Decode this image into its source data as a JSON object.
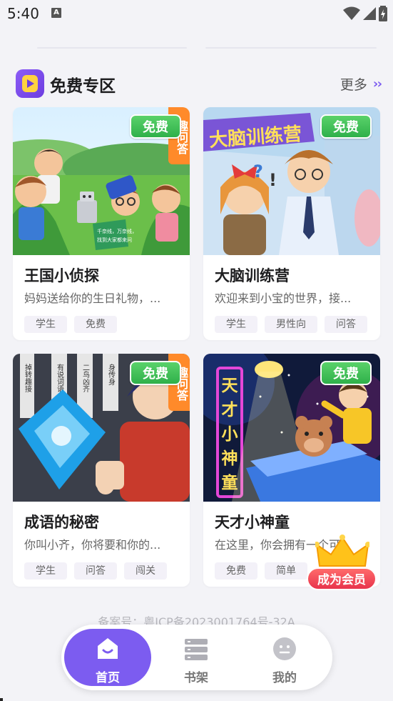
{
  "status_bar": {
    "time": "5:40",
    "notification_icon": "a-icon"
  },
  "section": {
    "title": "免费专区",
    "more_label": "更多",
    "more_icon": "double-chevron-right-icon"
  },
  "cards": [
    {
      "title": "王国小侦探",
      "description": "妈妈送给你的生日礼物，...",
      "badge": "免费",
      "tags": [
        "学生",
        "免费"
      ]
    },
    {
      "title": "大脑训练营",
      "description": "欢迎来到小宝的世界，接...",
      "badge": "免费",
      "tags": [
        "学生",
        "男性向",
        "问答"
      ]
    },
    {
      "title": "成语的秘密",
      "description": "你叫小齐，你将要和你的...",
      "badge": "免费",
      "tags": [
        "学生",
        "问答",
        "闯关"
      ]
    },
    {
      "title": "天才小神童",
      "description": "在这里，你会拥有一个可...",
      "badge": "免费",
      "tags": [
        "免费",
        "简单"
      ]
    }
  ],
  "artwork_text": {
    "qu_strip": "趣问答",
    "card1_sign": "千奈线，万奈线，找到大家都来问",
    "card2_banner": "大脑训练营",
    "card3_scroll_1": "掉转趣接",
    "card3_scroll_2": "有说词语",
    "card3_scroll_3": "二鸟凶齐",
    "card3_scroll_4": "身传身",
    "card4_banner": "天才小神童"
  },
  "icp": "备案号：粤ICP备2023001764号-32A",
  "member": {
    "label": "成为会员"
  },
  "nav": {
    "items": [
      {
        "label": "首页",
        "icon": "home-icon",
        "active": true
      },
      {
        "label": "书架",
        "icon": "bookshelf-icon",
        "active": false
      },
      {
        "label": "我的",
        "icon": "profile-icon",
        "active": false
      }
    ]
  },
  "colors": {
    "accent": "#7c5cf0",
    "free_badge": "#2fb04a",
    "member": "#e8344c",
    "background": "#f3f3f7"
  }
}
